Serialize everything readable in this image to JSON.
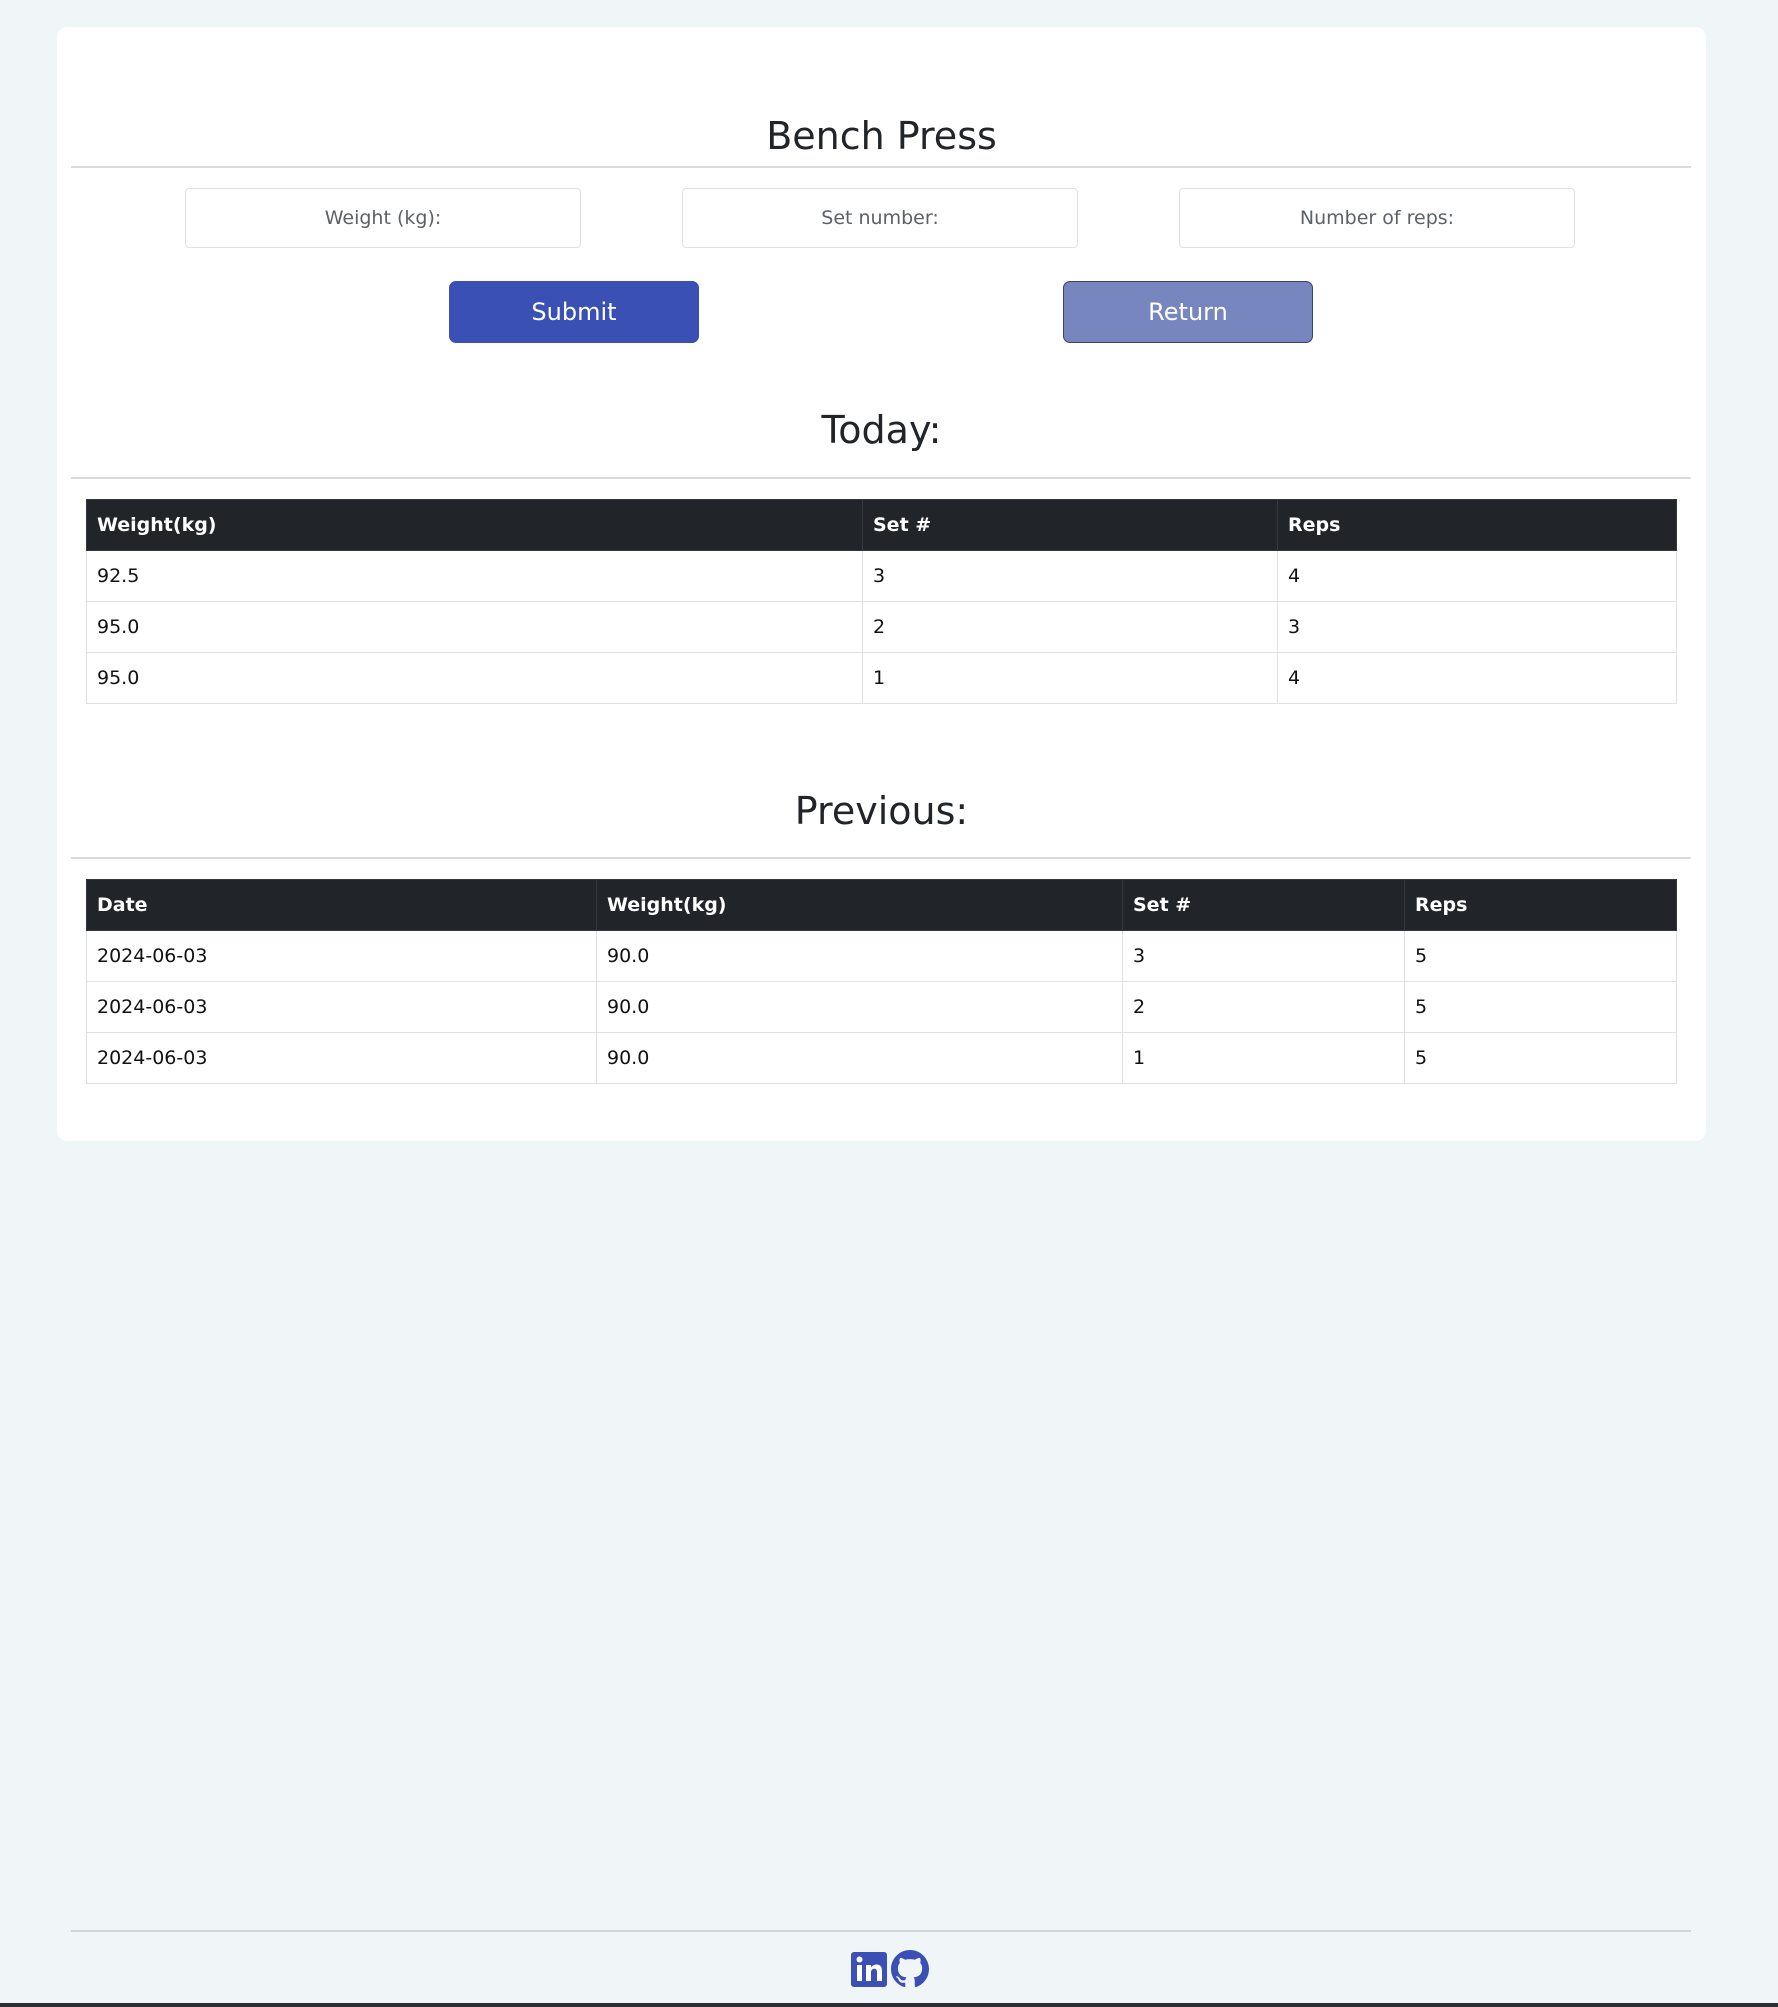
{
  "page": {
    "title": "Bench Press"
  },
  "form": {
    "weight_placeholder": "Weight (kg):",
    "set_placeholder": "Set number:",
    "reps_placeholder": "Number of reps:",
    "submit_label": "Submit",
    "return_label": "Return"
  },
  "today": {
    "heading": "Today:",
    "columns": [
      "Weight(kg)",
      "Set #",
      "Reps"
    ],
    "rows": [
      [
        "92.5",
        "3",
        "4"
      ],
      [
        "95.0",
        "2",
        "3"
      ],
      [
        "95.0",
        "1",
        "4"
      ]
    ]
  },
  "previous": {
    "heading": "Previous:",
    "columns": [
      "Date",
      "Weight(kg)",
      "Set #",
      "Reps"
    ],
    "rows": [
      [
        "2024-06-03",
        "90.0",
        "3",
        "5"
      ],
      [
        "2024-06-03",
        "90.0",
        "2",
        "5"
      ],
      [
        "2024-06-03",
        "90.0",
        "1",
        "5"
      ]
    ]
  },
  "footer": {
    "icons": [
      "linkedin-icon",
      "github-icon"
    ]
  },
  "colors": {
    "accent": "#3a50b5",
    "accent_muted": "#7786be",
    "table_header": "#212529",
    "background": "#f0f5f8"
  }
}
